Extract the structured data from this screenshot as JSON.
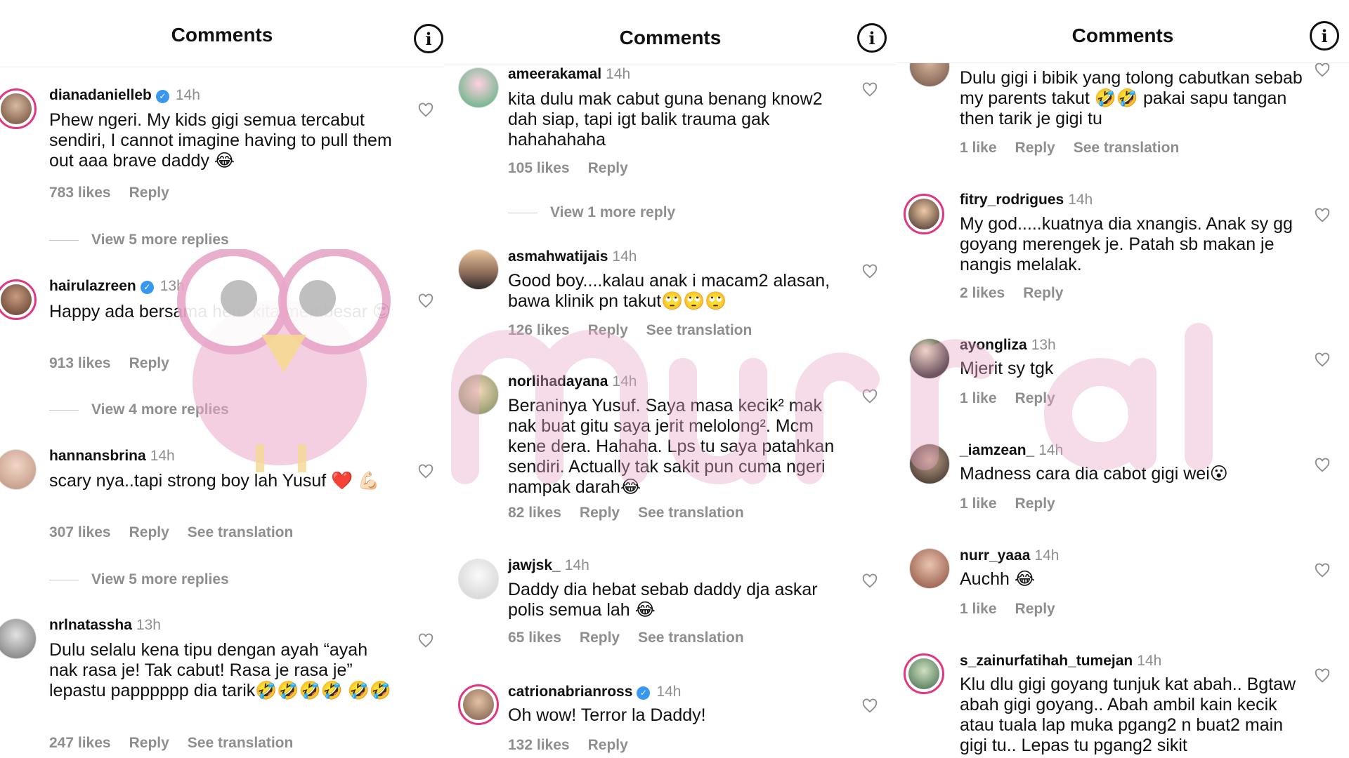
{
  "panels": [
    {
      "title": "Comments",
      "comments": [
        {
          "username": "dianadanielleb",
          "verified": true,
          "time": "14h",
          "text": "Phew ngeri. My kids gigi semua tercabut sendiri, I cannot imagine having to pull them out aaa brave daddy 😂",
          "likes": "783 likes",
          "reply": "Reply",
          "translation": "",
          "more_replies": "View 5 more replies"
        },
        {
          "username": "hairulazreen",
          "verified": true,
          "time": "13h",
          "text": "Happy ada bersama hero kita membesar 😍",
          "likes": "913 likes",
          "reply": "Reply",
          "translation": "",
          "more_replies": "View 4 more replies"
        },
        {
          "username": "hannansbrina",
          "verified": false,
          "time": "14h",
          "text": "scary nya..tapi strong boy lah Yusuf ❤️ 💪🏻",
          "likes": "307 likes",
          "reply": "Reply",
          "translation": "See translation",
          "more_replies": "View 5 more replies"
        },
        {
          "username": "nrlnatassha",
          "verified": false,
          "time": "13h",
          "text": "Dulu selalu kena tipu dengan ayah “ayah nak rasa je! Tak cabut! Rasa je rasa je” lepastu papppppp dia tarik🤣🤣🤣🤣 🤣🤣",
          "likes": "247 likes",
          "reply": "Reply",
          "translation": "See translation",
          "more_replies": ""
        }
      ]
    },
    {
      "title": "Comments",
      "comments": [
        {
          "username": "ameerakamal",
          "verified": false,
          "time": "14h",
          "text": "kita dulu mak cabut guna benang know2 dah siap, tapi igt balik trauma gak hahahahaha",
          "likes": "105 likes",
          "reply": "Reply",
          "translation": "",
          "more_replies": "View 1 more reply"
        },
        {
          "username": "asmahwatijais",
          "verified": false,
          "time": "14h",
          "text": "Good boy....kalau anak i macam2 alasan, bawa klinik pn takut🙄🙄🙄",
          "likes": "126 likes",
          "reply": "Reply",
          "translation": "See translation",
          "more_replies": ""
        },
        {
          "username": "norlihadayana",
          "verified": false,
          "time": "14h",
          "text": "Beraninya Yusuf. Saya masa kecik² mak nak buat gitu saya jerit melolong². Mcm kene dera. Hahaha. Lps tu saya patahkan sendiri. Actually tak sakit pun cuma ngeri nampak darah😂",
          "likes": "82 likes",
          "reply": "Reply",
          "translation": "See translation",
          "more_replies": ""
        },
        {
          "username": "jawjsk_",
          "verified": false,
          "time": "14h",
          "text": "Daddy dia hebat sebab daddy dja askar polis semua lah 😂",
          "likes": "65 likes",
          "reply": "Reply",
          "translation": "See translation",
          "more_replies": ""
        },
        {
          "username": "catrionabrianross",
          "verified": true,
          "time": "14h",
          "text": "Oh wow! Terror la Daddy!",
          "likes": "132 likes",
          "reply": "Reply",
          "translation": "",
          "more_replies": ""
        }
      ]
    },
    {
      "title": "Comments",
      "comments": [
        {
          "username": "",
          "verified": false,
          "time": "",
          "text": "Dulu gigi i bibik yang tolong cabutkan sebab my parents takut 🤣🤣 pakai sapu tangan then tarik je gigi tu",
          "likes": "1 like",
          "reply": "Reply",
          "translation": "See translation",
          "more_replies": ""
        },
        {
          "username": "fitry_rodrigues",
          "verified": false,
          "time": "14h",
          "text": "My god.....kuatnya dia xnangis. Anak sy gg goyang  merengek je. Patah sb makan je nangis melalak.",
          "likes": "2 likes",
          "reply": "Reply",
          "translation": "",
          "more_replies": ""
        },
        {
          "username": "ayongliza",
          "verified": false,
          "time": "13h",
          "text": "Mjerit sy tgk",
          "likes": "1 like",
          "reply": "Reply",
          "translation": "",
          "more_replies": ""
        },
        {
          "username": "_iamzean_",
          "verified": false,
          "time": "14h",
          "text": "Madness cara dia cabot gigi wei😮",
          "likes": "1 like",
          "reply": "Reply",
          "translation": "",
          "more_replies": ""
        },
        {
          "username": "nurr_yaaa",
          "verified": false,
          "time": "14h",
          "text": "Auchh 😂",
          "likes": "1 like",
          "reply": "Reply",
          "translation": "",
          "more_replies": ""
        },
        {
          "username": "s_zainurfatihah_tumejan",
          "verified": false,
          "time": "14h",
          "text": "Klu dlu gigi goyang tunjuk kat abah.. Bgtaw abah gigi goyang.. Abah ambil kain kecik atau tuala lap muka pgang2 n buat2 main gigi tu.. Lepas tu pgang2 sikit",
          "likes": "",
          "reply": "",
          "translation": "",
          "more_replies": ""
        }
      ]
    }
  ],
  "icons": {
    "info": "info-icon",
    "like": "heart-outline-icon",
    "verified": "verified-badge-icon"
  },
  "colors": {
    "story_ring": "#e2377f",
    "verified": "#3897f0",
    "muted": "#8e8e8e",
    "watermark": "#e9a7c9"
  }
}
